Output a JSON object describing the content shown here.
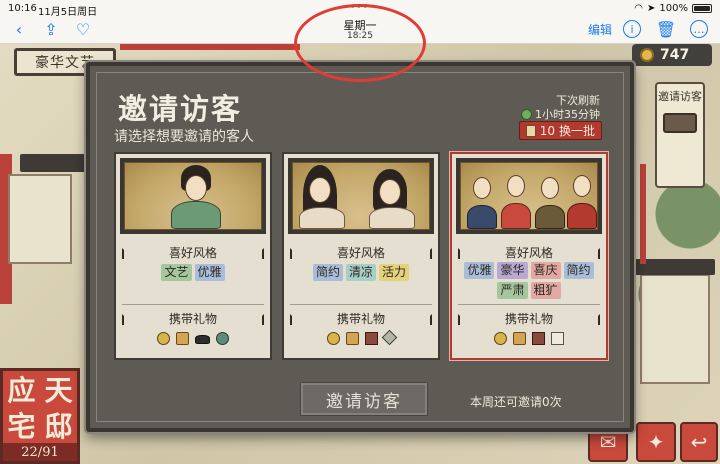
{
  "status_bar": {
    "time": "10:16",
    "date": "11月5日周日",
    "battery": "100%"
  },
  "toolbar": {
    "title": "星期一",
    "subtitle": "18:25",
    "edit_label": "编辑",
    "grabber": "•••"
  },
  "game": {
    "top_banner": "豪华文艺",
    "coins": "747",
    "side_card_label": "邀请访客",
    "mansion_chars": [
      "应",
      "天",
      "宅",
      "邸"
    ],
    "mansion_count": "22/91"
  },
  "dialog": {
    "title": "邀请访客",
    "subtitle": "请选择想要邀请的客人",
    "refresh_label": "下次刷新",
    "refresh_time": "1小时35分钟",
    "refresh_cost": "10",
    "refresh_button": "换一批",
    "style_header": "喜好风格",
    "gift_header": "携带礼物",
    "invite_button": "邀请访客",
    "weekly_remaining": "本周还可邀请0次",
    "guests": [
      {
        "styles": [
          {
            "label": "文艺",
            "color": "green"
          },
          {
            "label": "优雅",
            "color": "blue"
          }
        ],
        "gifts": [
          "coin-icon",
          "scroll-icon",
          "ingot-icon",
          "jade-icon"
        ]
      },
      {
        "styles": [
          {
            "label": "简约",
            "color": "blue"
          },
          {
            "label": "清凉",
            "color": "teal"
          },
          {
            "label": "活力",
            "color": "yellow"
          }
        ],
        "gifts": [
          "coin-icon",
          "scroll-icon",
          "book-icon",
          "fan-icon"
        ]
      },
      {
        "styles": [
          {
            "label": "优雅",
            "color": "blue"
          },
          {
            "label": "豪华",
            "color": "purple"
          },
          {
            "label": "喜庆",
            "color": "pink"
          },
          {
            "label": "简约",
            "color": "blue"
          },
          {
            "label": "严肃",
            "color": "green"
          },
          {
            "label": "粗犷",
            "color": "pink"
          }
        ],
        "gifts": [
          "coin-icon",
          "scroll-icon",
          "book-icon",
          "paper-icon"
        ]
      }
    ]
  }
}
